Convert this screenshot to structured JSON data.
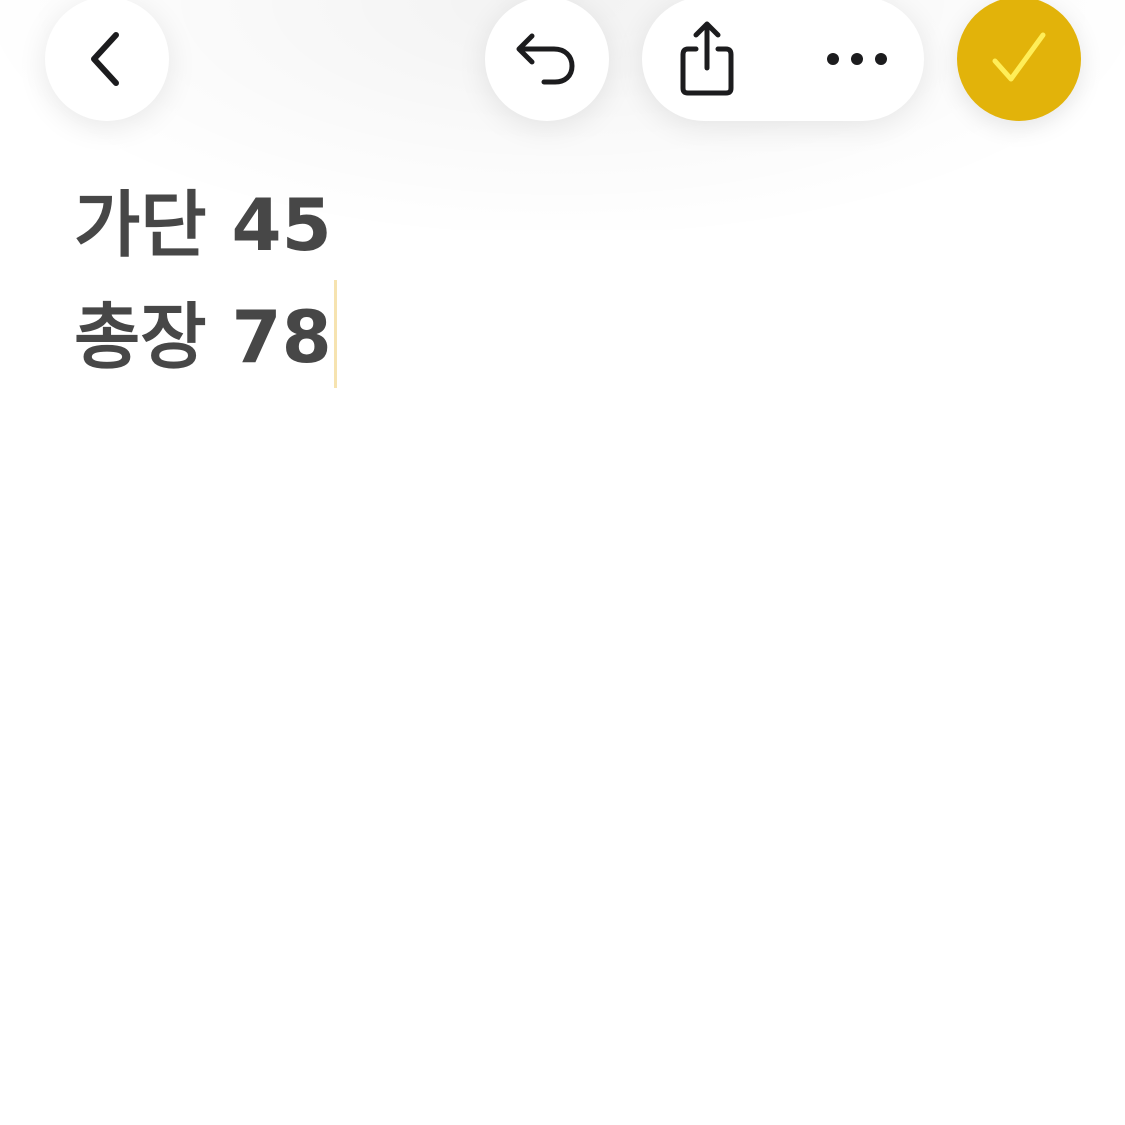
{
  "toolbar": {
    "back_icon": "chevron-left-icon",
    "undo_icon": "undo-arrow-icon",
    "share_icon": "share-icon",
    "more_icon": "ellipsis-icon",
    "done_icon": "checkmark-icon"
  },
  "colors": {
    "accent": "#e2b30a",
    "accent_check": "#ffee58",
    "text": "#474747",
    "icon": "#1c1c1e",
    "caret": "#f6e3b0"
  },
  "note": {
    "lines": [
      "가단 45",
      "총장 78"
    ]
  }
}
